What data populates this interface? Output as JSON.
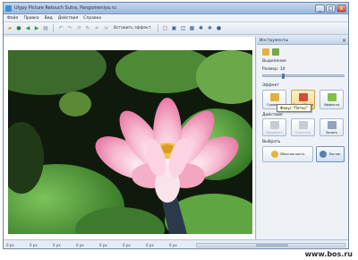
{
  "window": {
    "title": "Ulypy Picture Retouch Sutra, Pangomeniya.ru",
    "minimize_label": "_",
    "maximize_label": "□",
    "close_label": "x"
  },
  "menu": {
    "items": [
      "Файл",
      "Правка",
      "Вид",
      "Действия",
      "Справка"
    ]
  },
  "toolbar": {
    "icons": [
      "open-icon",
      "save-icon",
      "back-icon",
      "forward-icon",
      "print-icon",
      "undo-icon",
      "redo-icon",
      "rotate-left-icon",
      "rotate-right-icon",
      "crop-icon",
      "resize-icon"
    ],
    "action_label": "Вставить эффект",
    "right_icons": [
      "fit-icon",
      "zoom-in-icon",
      "zoom-out-icon",
      "fullscreen-icon",
      "color-icon",
      "settings-icon",
      "help-icon"
    ]
  },
  "side_panel": {
    "title": "Инструменты",
    "close_label": "×",
    "section_tools": "Выделение",
    "brush_size_label": "Размер: 10",
    "section_effects": "Эффект",
    "effects_row1": [
      {
        "label": "Границы",
        "active": false,
        "color": "#e0b040"
      },
      {
        "label": "Фокус Пятно",
        "active": true,
        "color": "#d84a3c"
      },
      {
        "label": "Эффекты",
        "active": false,
        "color": "#7fbf4a"
      }
    ],
    "tooltip": "Фокус \"Пятно\"",
    "section_actions": "Действия",
    "effects_row2": [
      {
        "label": "Выделить",
        "disabled": true
      },
      {
        "label": "Очистить",
        "disabled": true
      },
      {
        "label": "Залить",
        "disabled": false
      }
    ],
    "section_select": "Выбрать",
    "select_buttons": [
      {
        "label": "Обычная кисть",
        "selected": false
      },
      {
        "label": "Ластик",
        "selected": true
      }
    ]
  },
  "statusbar": {
    "cells": [
      "0 px",
      "0 px",
      "0 px",
      "0 px",
      "0 px",
      "0 px",
      "0 px",
      "0 px"
    ]
  },
  "watermark": "www.bos.ru"
}
